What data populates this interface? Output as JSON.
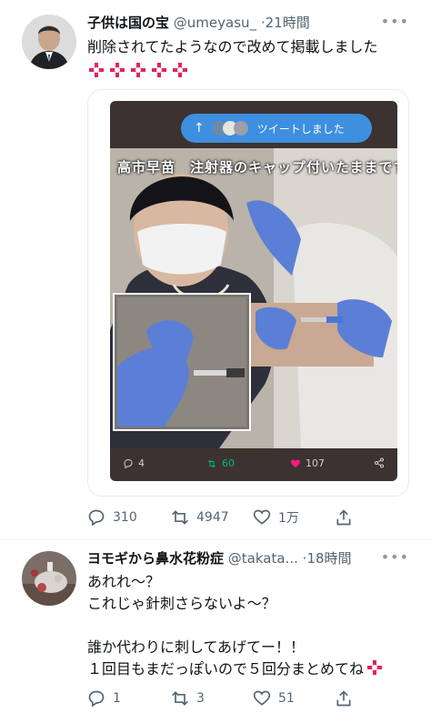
{
  "tweet1": {
    "display_name": "子供は国の宝",
    "handle": "@umeyasu_",
    "time": "21時間",
    "text": "削除されてたようなので改めて掲載しました",
    "emoji": [
      "anger-symbol",
      "anger-symbol",
      "anger-symbol",
      "anger-symbol",
      "anger-symbol"
    ],
    "embed": {
      "pill_label": "ツイートしました",
      "pill_arrow": "↑",
      "caption": "高市早苗　注射器のキャップ付いたままです",
      "replies": "4",
      "retweets": "60",
      "likes": "107"
    },
    "replies": "310",
    "retweets": "4947",
    "likes": "1万"
  },
  "tweet2": {
    "display_name": "ヨモギから鼻水花粉症",
    "handle": "@takata...",
    "time": "18時間",
    "lines": [
      "あれれ～？",
      "これじゃ針刺さらないよ～？",
      "",
      "誰か代わりに刺してあげてー！！",
      "１回目もまだっぽいので５回分まとめてね"
    ],
    "replies": "1",
    "retweets": "3",
    "likes": "51"
  },
  "colors": {
    "text": "#0f1419",
    "secondary": "#536471",
    "retweet_green": "#00ba7c",
    "like_pink": "#f91880",
    "pill_blue": "#3e8fe0",
    "anger_red": "#e0245e",
    "glove_blue": "#5b7fd6"
  },
  "icons": [
    "more-icon",
    "reply-icon",
    "retweet-icon",
    "like-icon",
    "share-icon"
  ]
}
